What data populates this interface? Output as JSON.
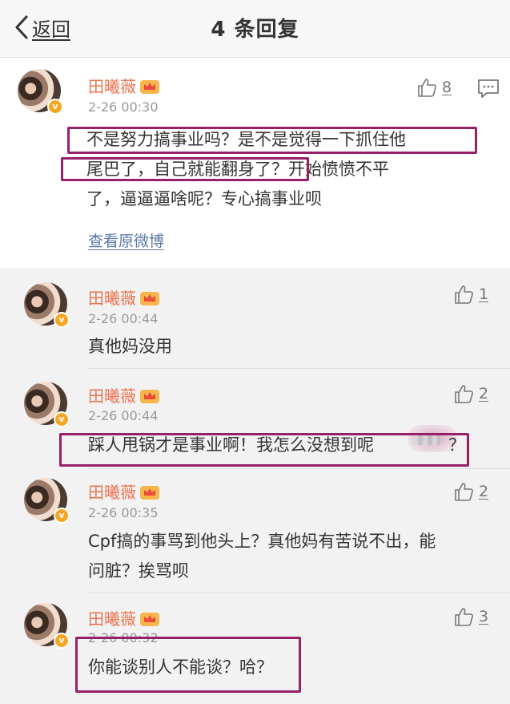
{
  "header": {
    "back_label": "返回",
    "title": "4 条回复"
  },
  "main_comment": {
    "user": "田曦薇",
    "time": "2-26 00:30",
    "likes": "8",
    "lines": [
      "不是努力搞事业吗？是不是觉得一下抓住他",
      "尾巴了，自己就能翻身了？开始愤愤不平",
      "了，逼逼逼啥呢？专心搞事业呗"
    ],
    "link": "查看原微博"
  },
  "replies": [
    {
      "user": "田曦薇",
      "time": "2-26 00:44",
      "likes": "1",
      "lines": [
        "真他妈没用"
      ]
    },
    {
      "user": "田曦薇",
      "time": "2-26 00:44",
      "likes": "2",
      "lines": [
        "踩人甩锅才是事业啊！我怎么没想到呢",
        "？"
      ]
    },
    {
      "user": "田曦薇",
      "time": "2-26 00:35",
      "likes": "2",
      "lines": [
        "Cpf搞的事骂到他头上？真他妈有苦说不出，能",
        "问脏？挨骂呗"
      ]
    },
    {
      "user": "田曦薇",
      "time": "2-26 00:32",
      "likes": "3",
      "lines": [
        "你能谈别人不能谈？哈？"
      ]
    }
  ],
  "colors": {
    "username": "#eb7350",
    "highlight_box": "#98206b",
    "link": "#5b7aa8"
  },
  "icons": [
    "chevron-left-icon",
    "crown-badge-icon",
    "verified-badge-icon",
    "thumbs-up-icon",
    "comment-icon"
  ]
}
